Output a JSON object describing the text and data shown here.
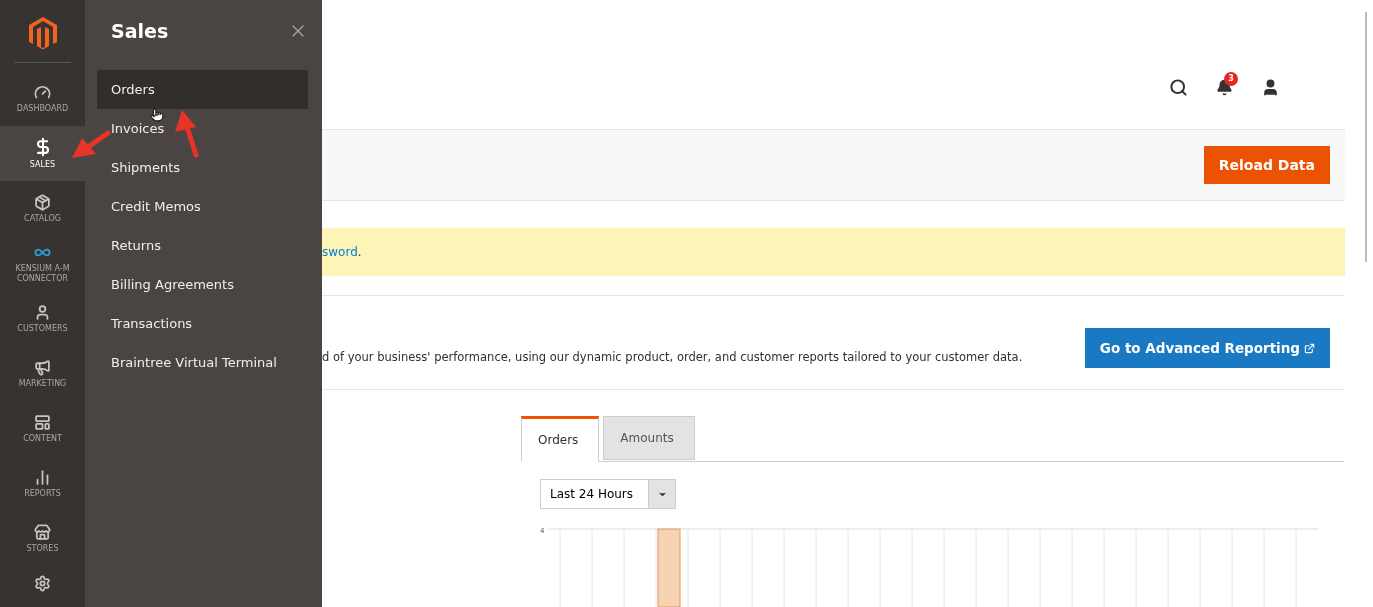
{
  "nav": {
    "items": [
      {
        "kind": "dashboard",
        "label": "DASHBOARD",
        "selected": false
      },
      {
        "kind": "sales",
        "label": "SALES",
        "selected": true
      },
      {
        "kind": "catalog",
        "label": "CATALOG",
        "selected": false
      },
      {
        "kind": "connector",
        "label": "KENSIUM A-M CONNECTOR",
        "selected": false
      },
      {
        "kind": "customers",
        "label": "CUSTOMERS",
        "selected": false
      },
      {
        "kind": "marketing",
        "label": "MARKETING",
        "selected": false
      },
      {
        "kind": "content",
        "label": "CONTENT",
        "selected": false
      },
      {
        "kind": "reports",
        "label": "REPORTS",
        "selected": false
      },
      {
        "kind": "stores",
        "label": "STORES",
        "selected": false
      },
      {
        "kind": "settings",
        "selected": false
      }
    ]
  },
  "flyout": {
    "title": "Sales",
    "items": [
      {
        "label": "Orders",
        "selected": true
      },
      {
        "label": "Invoices",
        "selected": false
      },
      {
        "label": "Shipments",
        "selected": false
      },
      {
        "label": "Credit Memos",
        "selected": false
      },
      {
        "label": "Returns",
        "selected": false
      },
      {
        "label": "Billing Agreements",
        "selected": false
      },
      {
        "label": "Transactions",
        "selected": false
      },
      {
        "label": "Braintree Virtual Terminal",
        "selected": false
      }
    ]
  },
  "header": {
    "notification_count": "3"
  },
  "toolbar": {
    "button": "Reload Data"
  },
  "notice": {
    "link": "sword",
    "suffix": "."
  },
  "reporting": {
    "description": "d of your business' performance, using our dynamic product, order, and customer reports tailored to your customer data.",
    "button": "Go to Advanced Reporting"
  },
  "dashboard": {
    "tabs": [
      {
        "label": "Orders",
        "selected": true
      },
      {
        "label": "Amounts",
        "selected": false
      }
    ],
    "period": "Last 24 Hours",
    "chart_axis_label": "4"
  }
}
